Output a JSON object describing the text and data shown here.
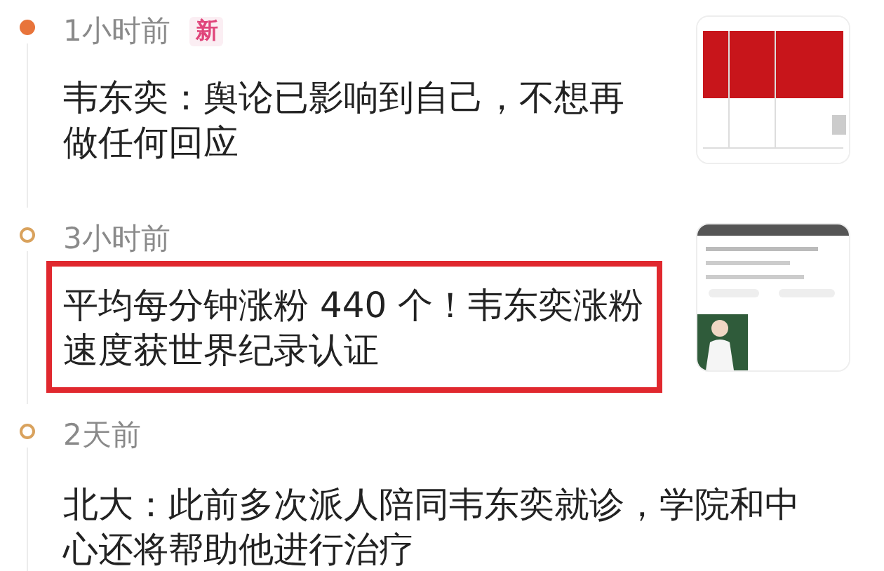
{
  "feed": [
    {
      "time": "1小时前",
      "badge": "新",
      "latest": true,
      "highlighted": false,
      "headline": "韦东奕：舆论已影响到自己，不想再做任何回应"
    },
    {
      "time": "3小时前",
      "latest": false,
      "highlighted": true,
      "headline": "平均每分钟涨粉 440 个！韦东奕涨粉速度获世界纪录认证"
    },
    {
      "time": "2天前",
      "latest": false,
      "highlighted": false,
      "headline": "北大：此前多次派人陪同韦东奕就诊，学院和中心还将帮助他进行治疗"
    }
  ]
}
